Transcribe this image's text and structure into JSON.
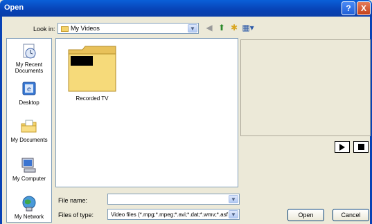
{
  "window": {
    "title": "Open",
    "help_glyph": "?",
    "close_glyph": "X"
  },
  "lookin": {
    "label": "Look in:",
    "value": "My Videos"
  },
  "places": {
    "recent": "My Recent Documents",
    "desktop": "Desktop",
    "documents": "My Documents",
    "computer": "My Computer",
    "network": "My Network"
  },
  "files": [
    {
      "name": "Recorded TV"
    }
  ],
  "form": {
    "filename_label": "File name:",
    "filename_value": "",
    "filetype_label": "Files of type:",
    "filetype_value": "Video files (*.mpg;*.mpeg;*.avi;*.dat;*.wmv;*.asf"
  },
  "buttons": {
    "open": "Open",
    "cancel": "Cancel"
  },
  "colors": {
    "titlebar": "#0842b5",
    "face": "#ece9d8",
    "field_border": "#7f9db9"
  }
}
